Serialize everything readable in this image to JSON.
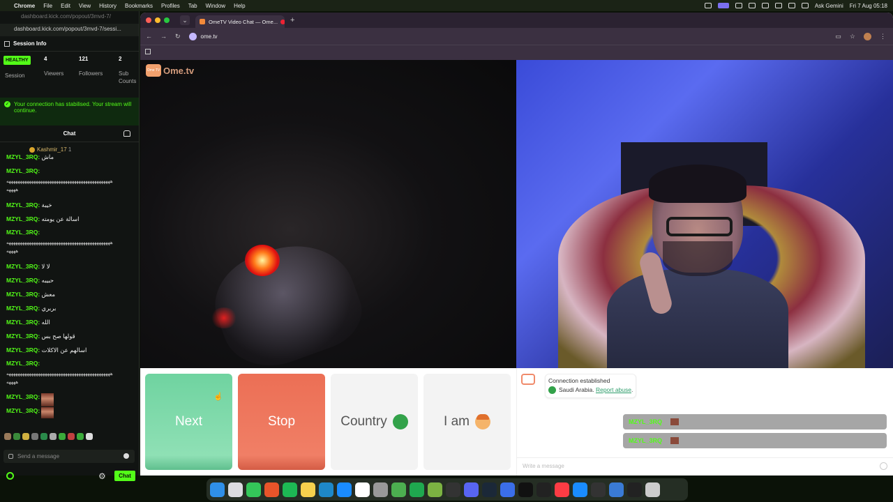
{
  "menubar": {
    "app": "Chrome",
    "items": [
      "File",
      "Edit",
      "View",
      "History",
      "Bookmarks",
      "Profiles",
      "Tab",
      "Window",
      "Help"
    ],
    "gemini": "Ask Gemini",
    "clock": "Fri 7 Aug 05:18"
  },
  "popout": {
    "url_ghost": "dashboard.kick.com/popout/3mvd-7/",
    "url": "dashboard.kick.com/popout/3mvd-7/sessi...",
    "session_title": "Session Info",
    "healthy": "HEALTHY",
    "session_label": "Session",
    "stats": [
      {
        "num": "4",
        "label": "Viewers"
      },
      {
        "num": "121",
        "label": "Followers"
      },
      {
        "num": "2",
        "label": "Sub Counts"
      }
    ],
    "notice": "Your connection has stabilised. Your stream will continue.",
    "chat_title": "Chat",
    "pinned_user": "Kashmir_17",
    "pinned_count": "1",
    "messages": [
      {
        "user": "MZYL_3RQ:",
        "text": "ماش"
      },
      {
        "user": "MZYL_3RQ:",
        "text": ""
      },
      {
        "user": "",
        "text": "ههههههههههههههههههههههههههههههههههههههههههههههه"
      },
      {
        "user": "",
        "text": "ههههه"
      },
      {
        "user": "MZYL_3RQ:",
        "text": "خيبة"
      },
      {
        "user": "MZYL_3RQ:",
        "text": "اسالة عن يومته"
      },
      {
        "user": "MZYL_3RQ:",
        "text": ""
      },
      {
        "user": "",
        "text": "ههههههههههههههههههههههههههههههههههههههههههههههه"
      },
      {
        "user": "",
        "text": "ههههه"
      },
      {
        "user": "MZYL_3RQ:",
        "text": "لا لا"
      },
      {
        "user": "MZYL_3RQ:",
        "text": "حبيبه"
      },
      {
        "user": "MZYL_3RQ:",
        "text": "معش"
      },
      {
        "user": "MZYL_3RQ:",
        "text": "بربري"
      },
      {
        "user": "MZYL_3RQ:",
        "text": "الله"
      },
      {
        "user": "MZYL_3RQ:",
        "text": "قولها صح بس"
      },
      {
        "user": "MZYL_3RQ:",
        "text": "اسالهم عن الاكلات"
      },
      {
        "user": "MZYL_3RQ:",
        "text": ""
      },
      {
        "user": "",
        "text": "ههههههههههههههههههههههههههههههههههههههههههههههه"
      },
      {
        "user": "",
        "text": "ههههه"
      },
      {
        "user": "MZYL_3RQ:",
        "text": ""
      },
      {
        "user": "MZYL_3RQ:",
        "text": ""
      }
    ],
    "send_placeholder": "Send a message",
    "chat_button": "Chat"
  },
  "browser": {
    "tab_title": "OmeTV Video Chat — Ome...",
    "url": "ome.tv"
  },
  "ome": {
    "logo": "Ome.tv",
    "logo_badge": "Ome TV",
    "buttons": {
      "next": "Next",
      "stop": "Stop",
      "country": "Country",
      "iam": "I am"
    },
    "system_line1": "Connection established",
    "system_country": "Saudi Arabia.",
    "system_link": "Report abuse",
    "chat_rows": [
      "MZYL_3RQ",
      "MZYL_3RQ"
    ],
    "write_placeholder": "Write a message"
  },
  "colors": {
    "kick_green": "#53fc18",
    "next_green": "#6fd3a0",
    "stop_red": "#ec6f55",
    "browser_chrome": "#3b3041"
  }
}
